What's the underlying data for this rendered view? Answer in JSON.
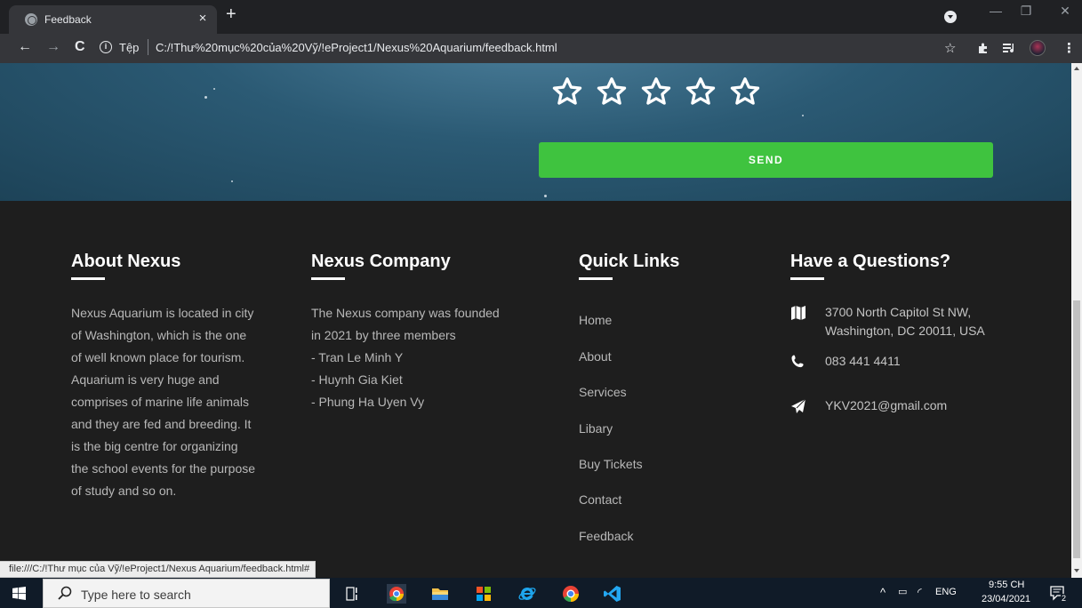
{
  "browser": {
    "tab_title": "Feedback",
    "tab_close": "×",
    "new_tab": "+",
    "omnibox_label": "Tệp",
    "url": "C:/!Thư%20mục%20của%20Vỹ/!eProject1/Nexus%20Aquarium/feedback.html"
  },
  "hero": {
    "rating": {
      "value": 0,
      "max": 5
    },
    "send_button": "SEND"
  },
  "footer": {
    "about": {
      "title": "About Nexus",
      "lines": [
        "Nexus Aquarium is located in city",
        "of Washington, which is the one",
        "of well known place for tourism.",
        "Aquarium is very huge and",
        "comprises of marine life animals",
        "and they are fed and breeding. It",
        "is the big centre for organizing",
        "the school events for the purpose",
        "of study and so on."
      ]
    },
    "company": {
      "title": "Nexus Company",
      "lines": [
        "The Nexus company was founded",
        "in 2021 by three members",
        "- Tran Le Minh Y",
        "- Huynh Gia Kiet",
        "- Phung Ha Uyen Vy"
      ]
    },
    "quick_links": {
      "title": "Quick Links",
      "items": [
        "Home",
        "About",
        "Services",
        "Libary",
        "Buy Tickets",
        "Contact",
        "Feedback"
      ]
    },
    "questions": {
      "title": "Have a Questions?",
      "address_line1": "3700 North Capitol St NW,",
      "address_line2": "Washington, DC 20011, USA",
      "phone": "083 441 4411",
      "email": "YKV2021@gmail.com"
    }
  },
  "status_url": "file:///C:/!Thư mục của Vỹ/!eProject1/Nexus Aquarium/feedback.html#",
  "taskbar": {
    "search_placeholder": "Type here to search",
    "language": "ENG",
    "time": "9:55 CH",
    "date": "23/04/2021",
    "notification_count": "2"
  },
  "colors": {
    "send_button": "#3fc33f",
    "footer_bg": "#1e1e1e",
    "hero_bg": "#2b5a74"
  }
}
